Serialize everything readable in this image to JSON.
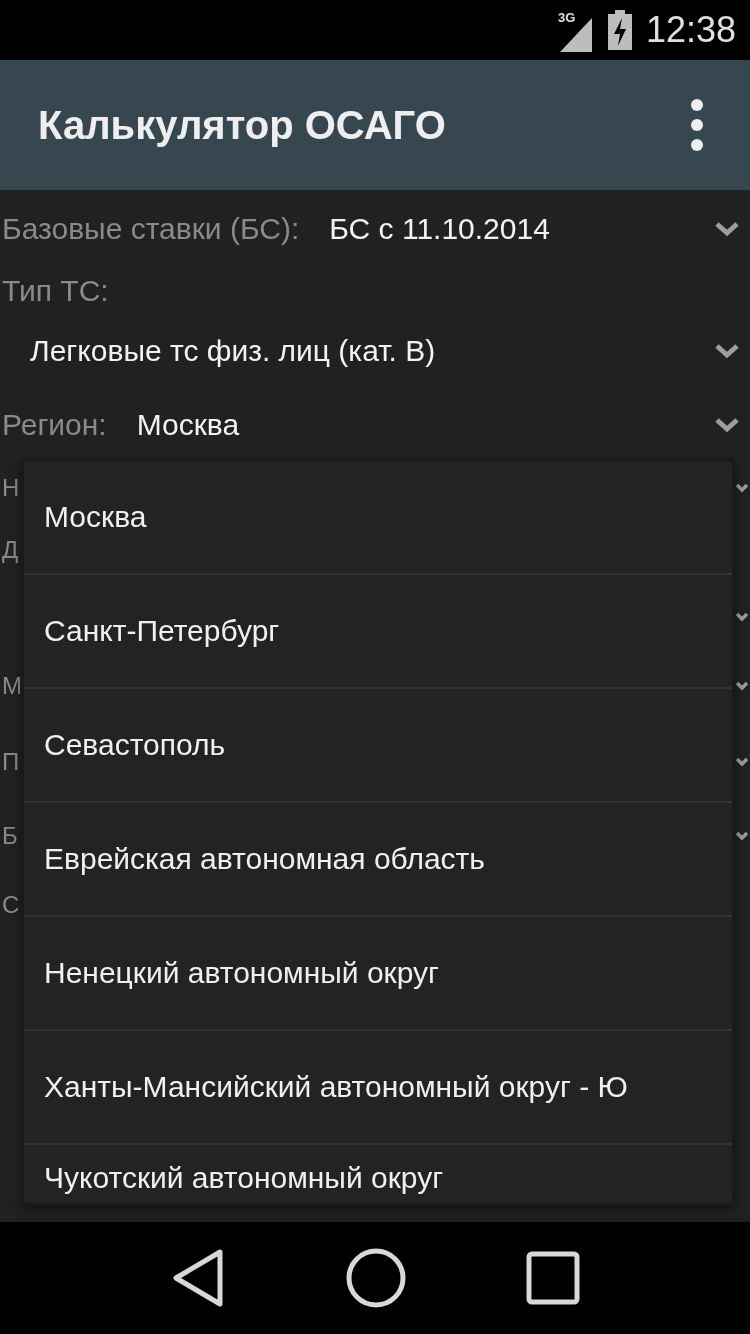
{
  "status_bar": {
    "network": "3G",
    "time": "12:38"
  },
  "app_bar": {
    "title": "Калькулятор ОСАГО"
  },
  "fields": [
    {
      "kind": "inline",
      "label": "Базовые ставки (БС):",
      "value": "БС с 11.10.2014"
    },
    {
      "kind": "stacked",
      "label": "Тип ТС:",
      "value": "Легковые тс физ. лиц (кат. B)"
    },
    {
      "kind": "inline",
      "label": "Регион:",
      "value": "Москва"
    }
  ],
  "obscured_rows": [
    {
      "kind": "dropdown",
      "label": "Н"
    },
    {
      "kind": "label",
      "label": "Д"
    },
    {
      "kind": "dropdown"
    },
    {
      "kind": "dropdown",
      "label": "М"
    },
    {
      "kind": "dropdown",
      "label": "П"
    },
    {
      "kind": "dropdown",
      "label": "Б"
    },
    {
      "kind": "label",
      "label": "С"
    }
  ],
  "region_menu": {
    "items": [
      "Москва",
      "Санкт-Петербург",
      "Севастополь",
      "Еврейская автономная область",
      "Ненецкий автономный округ",
      "Ханты-Мансийский автономный округ - Ю",
      "Чукотский автономный округ"
    ]
  }
}
